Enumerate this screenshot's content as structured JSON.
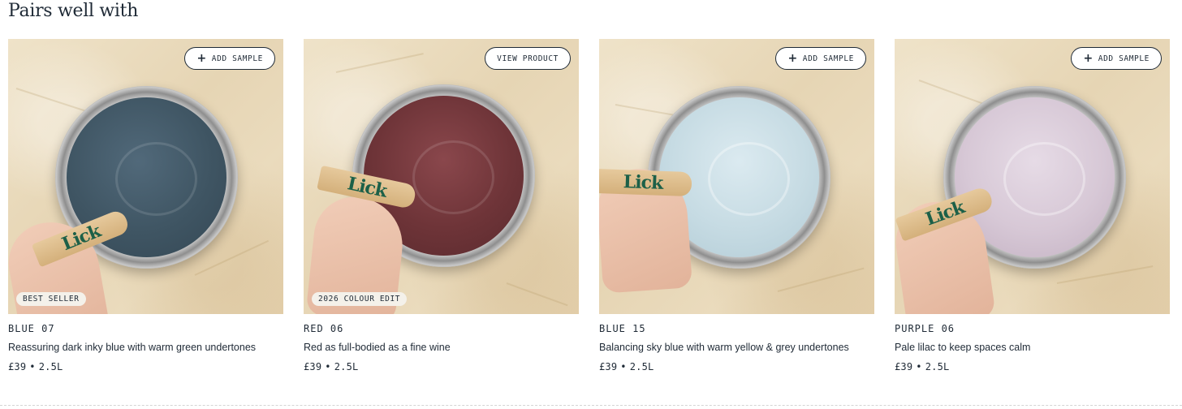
{
  "section": {
    "title": "Pairs well with"
  },
  "products": [
    {
      "name": "BLUE 07",
      "description": "Reassuring dark inky blue with warm green undertones",
      "price": "£39",
      "size": "2.5L",
      "button_label": "ADD SAMPLE",
      "button_icon": "plus-icon",
      "badge": "BEST SELLER",
      "paint_color": "#3f5563",
      "logo_text": "Lick"
    },
    {
      "name": "RED 06",
      "description": "Red as full-bodied as a fine wine",
      "price": "£39",
      "size": "2.5L",
      "button_label": "VIEW PRODUCT",
      "button_icon": "",
      "badge": "2026 COLOUR EDIT",
      "paint_color": "#6e3438",
      "logo_text": "Lick"
    },
    {
      "name": "BLUE 15",
      "description": "Balancing sky blue with warm yellow & grey undertones",
      "price": "£39",
      "size": "2.5L",
      "button_label": "ADD SAMPLE",
      "button_icon": "plus-icon",
      "badge": "",
      "paint_color": "#c6dbe3",
      "logo_text": "Lick"
    },
    {
      "name": "PURPLE 06",
      "description": "Pale lilac to keep spaces calm",
      "price": "£39",
      "size": "2.5L",
      "button_label": "ADD SAMPLE",
      "button_icon": "plus-icon",
      "badge": "",
      "paint_color": "#d7c8d6",
      "logo_text": "Lick"
    }
  ],
  "price_separator": "•",
  "colors": {
    "text": "#1f2a36",
    "badge_bg": "#f4f1ea",
    "canvas": "#e9dabb"
  }
}
